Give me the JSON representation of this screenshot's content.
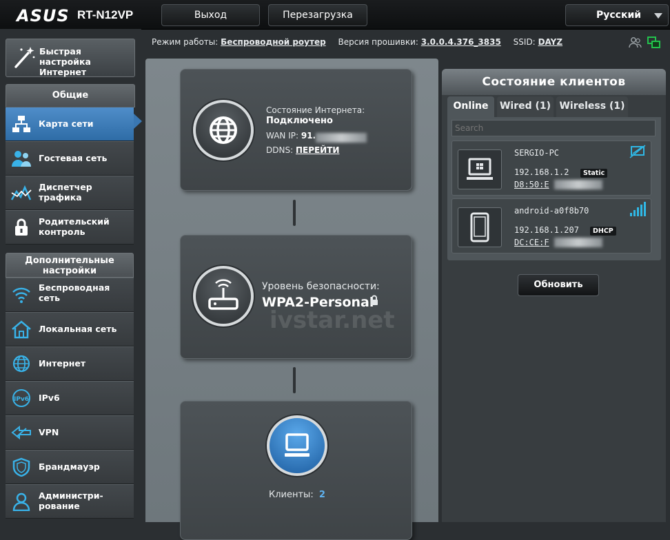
{
  "header": {
    "brand": "ASUS",
    "model": "RT-N12VP",
    "logout_label": "Выход",
    "reboot_label": "Перезагрузка",
    "language": "Русский"
  },
  "info": {
    "mode_label": "Режим работы:",
    "mode_value": "Беспроводной роутер",
    "fw_label": "Версия прошивки:",
    "fw_value": "3.0.0.4.376_3835",
    "ssid_label": "SSID:",
    "ssid_value": "DAYZ"
  },
  "sidebar": {
    "quick_setup": "Быстрая настройка Интернет",
    "general_header": "Общие",
    "general_items": [
      {
        "label": "Карта сети",
        "icon": "network-map-icon"
      },
      {
        "label": "Гостевая сеть",
        "icon": "guest-network-icon"
      },
      {
        "label": "Диспетчер трафика",
        "icon": "traffic-manager-icon"
      },
      {
        "label": "Родительский контроль",
        "icon": "parental-control-icon"
      }
    ],
    "advanced_header": "Дополнительные настройки",
    "advanced_items": [
      {
        "label": "Беспроводная сеть",
        "icon": "wireless-icon"
      },
      {
        "label": "Локальная сеть",
        "icon": "lan-home-icon"
      },
      {
        "label": "Интернет",
        "icon": "globe-icon"
      },
      {
        "label": "IPv6",
        "icon": "ipv6-icon"
      },
      {
        "label": "VPN",
        "icon": "vpn-icon"
      },
      {
        "label": "Брандмауэр",
        "icon": "firewall-shield-icon"
      },
      {
        "label": "Администри-рование",
        "icon": "admin-user-icon"
      }
    ]
  },
  "map": {
    "internet": {
      "status_label": "Состояние Интернета:",
      "status_value": "Подключено",
      "wan_label": "WAN IP:",
      "wan_value": "91.",
      "ddns_label": "DDNS:",
      "ddns_link": "ПЕРЕЙТИ"
    },
    "security": {
      "label": "Уровень безопасности:",
      "value": "WPA2-Personal"
    },
    "clients": {
      "label": "Клиенты:",
      "count": "2"
    },
    "watermark": "ivstar.net"
  },
  "clients_panel": {
    "title": "Состояние клиентов",
    "tabs": [
      {
        "label": "Online"
      },
      {
        "label": "Wired (1)"
      },
      {
        "label": "Wireless (1)"
      }
    ],
    "search_placeholder": "Search",
    "items": [
      {
        "name": "SERGIO-PC",
        "ip": "192.168.1.2",
        "type": "Static",
        "mac": "D8:50:E"
      },
      {
        "name": "android-a0f8b70",
        "ip": "192.168.1.207",
        "type": "DHCP",
        "mac": "DC:CE:F"
      }
    ],
    "refresh_label": "Обновить"
  },
  "colors": {
    "accent_blue": "#3a77b2",
    "signal_cyan": "#2fb8e6",
    "link_green": "#22c24c"
  }
}
